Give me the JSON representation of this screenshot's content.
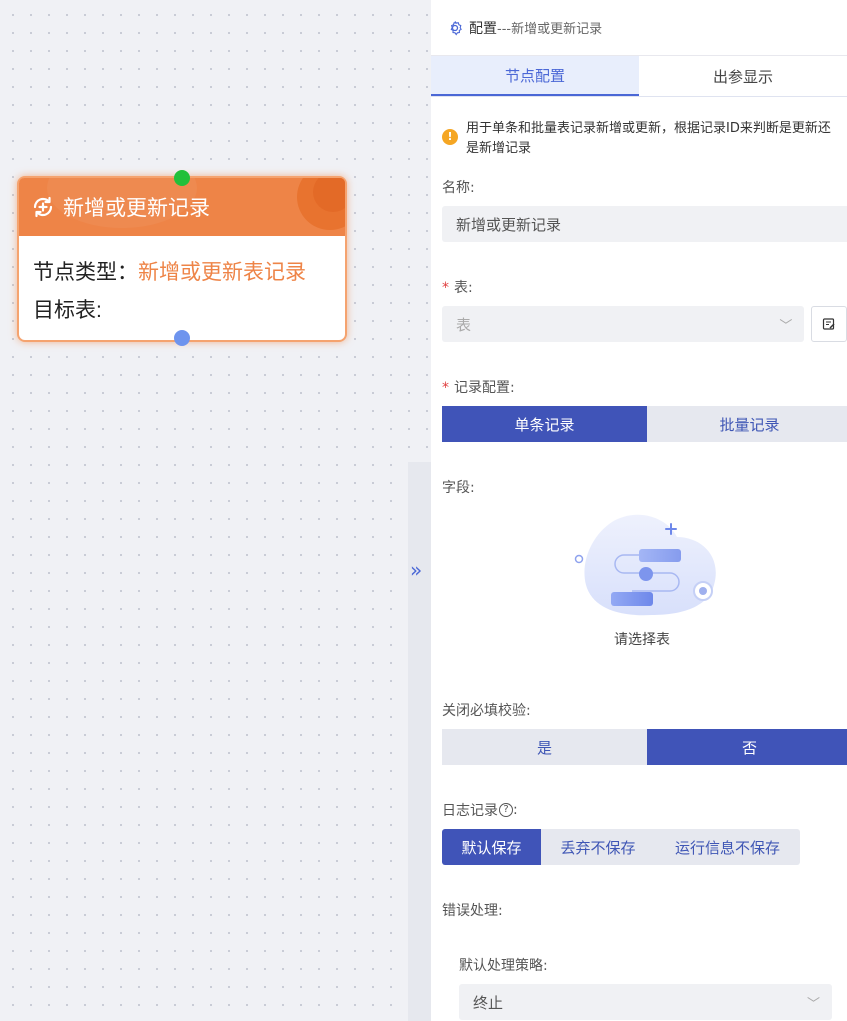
{
  "node": {
    "title": "新增或更新记录",
    "type_label": "节点类型：",
    "type_value": "新增或更新表记录",
    "target_label": "目标表:"
  },
  "panel": {
    "title_main": "配置",
    "title_sub": "---新增或更新记录",
    "tabs": [
      {
        "label": "节点配置",
        "active": true
      },
      {
        "label": "出参显示",
        "active": false
      }
    ],
    "notice_line1": "用于单条和批量表记录新增或更新，根据记录ID来判断是更新还",
    "notice_line2": "是新增记录",
    "name": {
      "label": "名称:",
      "value": "新增或更新记录"
    },
    "table": {
      "label": "表:",
      "placeholder": "表"
    },
    "record_config": {
      "label": "记录配置:",
      "options": [
        "单条记录",
        "批量记录"
      ],
      "selected": "单条记录"
    },
    "fields": {
      "label": "字段:",
      "empty_text": "请选择表"
    },
    "close_required": {
      "label": "关闭必填校验:",
      "options": [
        "是",
        "否"
      ],
      "selected": "否"
    },
    "log": {
      "label": "日志记录",
      "options": [
        "默认保存",
        "丢弃不保存",
        "运行信息不保存"
      ],
      "selected": "默认保存"
    },
    "error": {
      "label": "错误处理:",
      "strategy_label": "默认处理策略:",
      "strategy_value": "终止"
    }
  },
  "colors": {
    "accent": "#4054b8",
    "node_orange": "#ee8447",
    "required": "#e03e3e"
  }
}
